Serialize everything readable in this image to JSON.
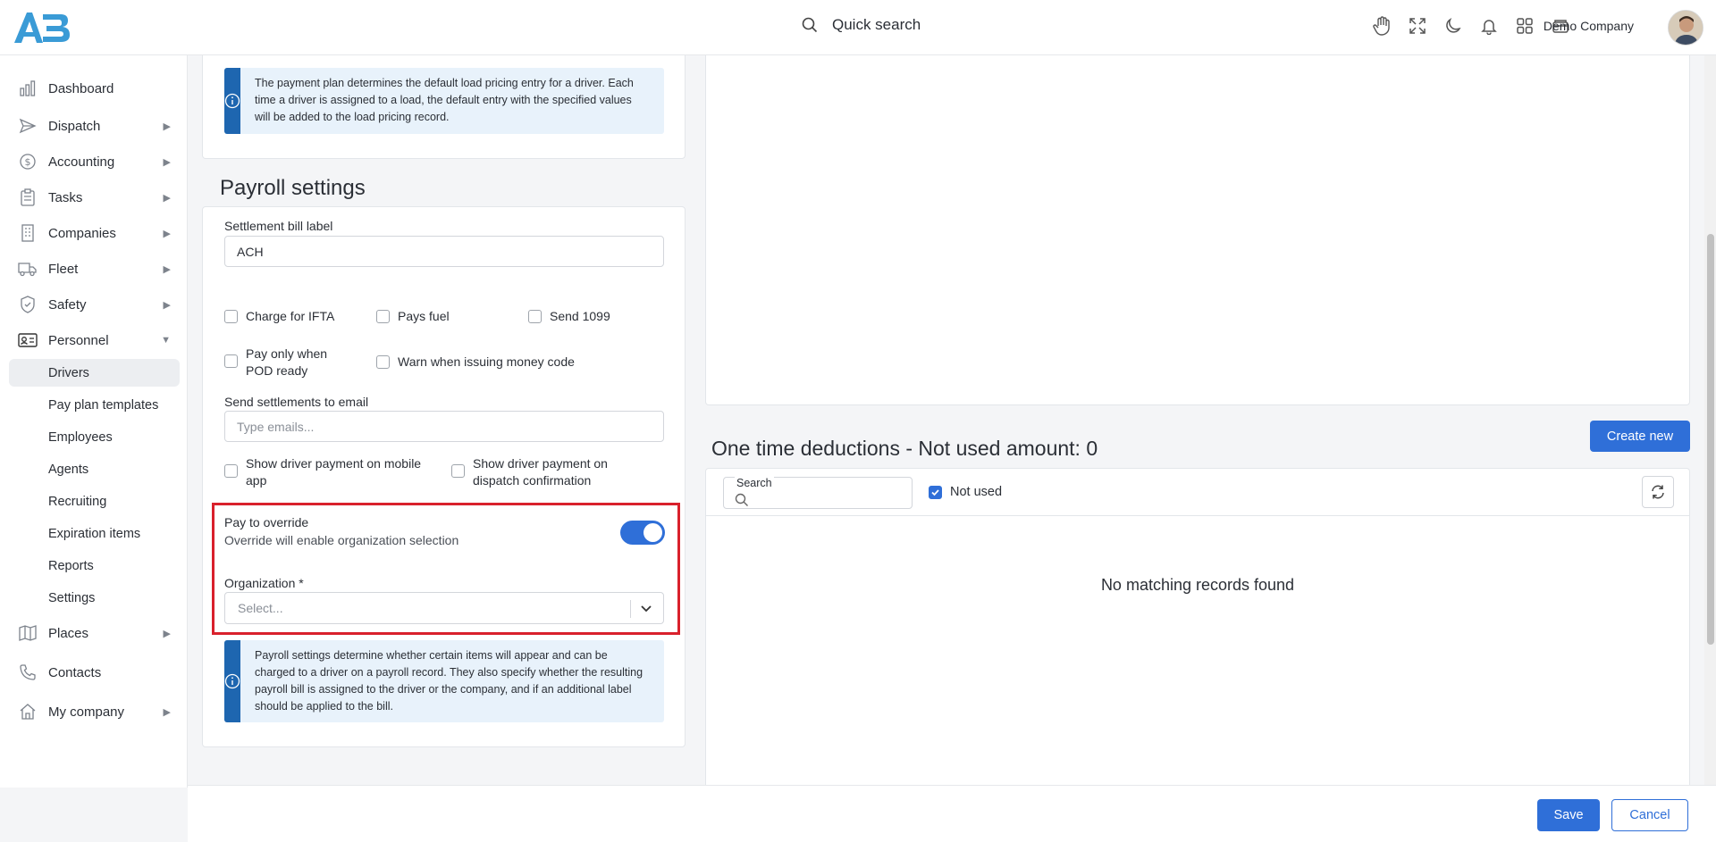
{
  "header": {
    "quick_search": "Quick search",
    "company": "Demo Company",
    "icons": [
      "hand-icon",
      "fullscreen-icon",
      "moon-icon",
      "bell-icon",
      "apps-grid-icon",
      "wallet-icon"
    ]
  },
  "sidebar": {
    "items": [
      {
        "label": "Dashboard",
        "icon": "chart-icon"
      },
      {
        "label": "Dispatch",
        "icon": "send-icon"
      },
      {
        "label": "Accounting",
        "icon": "dollar-icon"
      },
      {
        "label": "Tasks",
        "icon": "clipboard-icon"
      },
      {
        "label": "Companies",
        "icon": "building-icon"
      },
      {
        "label": "Fleet",
        "icon": "truck-icon"
      },
      {
        "label": "Safety",
        "icon": "shield-icon"
      },
      {
        "label": "Personnel",
        "icon": "id-card-icon"
      },
      {
        "label": "Places",
        "icon": "map-icon"
      },
      {
        "label": "Contacts",
        "icon": "phone-icon"
      },
      {
        "label": "My company",
        "icon": "home-icon"
      }
    ],
    "personnel_sub": [
      "Drivers",
      "Pay plan templates",
      "Employees",
      "Agents",
      "Recruiting",
      "Expiration items",
      "Reports",
      "Settings"
    ]
  },
  "pay_plan": {
    "info": "The payment plan determines the default load pricing entry for a driver. Each time a driver is assigned to a load, the default entry with the specified values will be added to the load pricing record."
  },
  "payroll": {
    "title": "Payroll settings",
    "settlement_label": "Settlement bill label",
    "settlement_value": "ACH",
    "charge_ifta": "Charge for IFTA",
    "pays_fuel": "Pays fuel",
    "send_1099": "Send 1099",
    "pay_pod_1": "Pay only when",
    "pay_pod_2": "POD ready",
    "warn_money_code": "Warn when issuing money code",
    "email_label": "Send settlements to email",
    "email_placeholder": "Type emails...",
    "show_mobile_1": "Show driver payment on mobile",
    "show_mobile_2": "app",
    "show_dispatch_1": "Show driver payment on",
    "show_dispatch_2": "dispatch confirmation",
    "override_title": "Pay to override",
    "override_desc": "Override will enable organization selection",
    "org_label": "Organization *",
    "org_placeholder": "Select...",
    "info": "Payroll settings determine whether certain items will appear and can be charged to a driver on a payroll record. They also specify whether the resulting payroll bill is assigned to the driver or the company, and if an additional label should be applied to the bill."
  },
  "deductions": {
    "create_new": "Create new",
    "title": "One time deductions - Not used amount: 0",
    "search_label": "Search",
    "not_used": "Not used",
    "empty": "No matching records found"
  },
  "footer": {
    "save": "Save",
    "cancel": "Cancel"
  },
  "colors": {
    "primary": "#2f6fd8",
    "info_bar": "#1e66b0",
    "highlight": "#d9212c"
  }
}
